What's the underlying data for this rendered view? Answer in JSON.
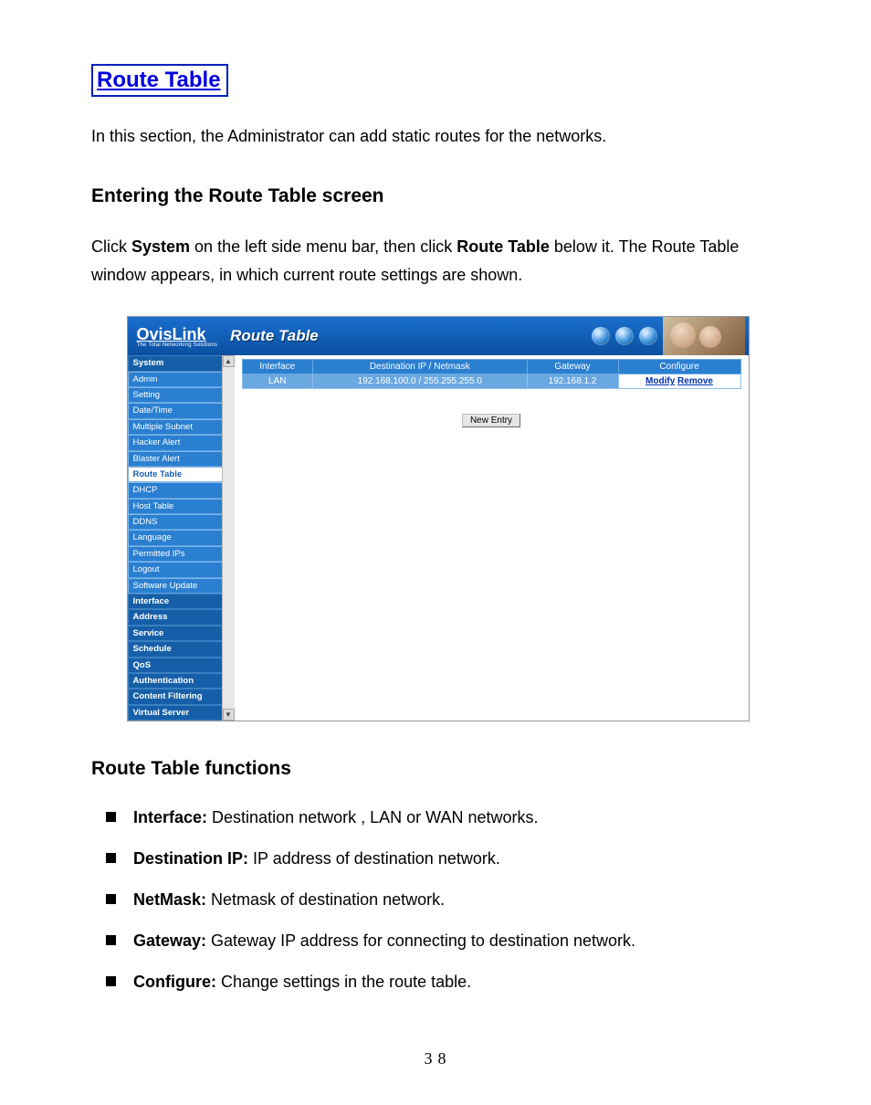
{
  "doc": {
    "section_title": "Route Table",
    "intro": "In this section, the Administrator can add static routes for the networks.",
    "sub1": "Entering the Route Table screen",
    "para1_a": "Click ",
    "para1_b": "System",
    "para1_c": " on the left side menu bar, then click ",
    "para1_d": "Route Table",
    "para1_e": " below it. The Route Table window appears, in which current route settings are shown.",
    "sub2": "Route Table functions",
    "page_number": "38"
  },
  "app": {
    "brand": "OvisLink",
    "brand_sub": "The Total Networking Solutions",
    "page_title": "Route Table",
    "sidebar": [
      {
        "label": "System",
        "type": "group"
      },
      {
        "label": "Admin",
        "type": "item"
      },
      {
        "label": "Setting",
        "type": "item"
      },
      {
        "label": "Date/Time",
        "type": "item"
      },
      {
        "label": "Multiple Subnet",
        "type": "item"
      },
      {
        "label": "Hacker Alert",
        "type": "item"
      },
      {
        "label": "Blaster Alert",
        "type": "item"
      },
      {
        "label": "Route Table",
        "type": "active"
      },
      {
        "label": "DHCP",
        "type": "item"
      },
      {
        "label": "Host Table",
        "type": "item"
      },
      {
        "label": "DDNS",
        "type": "item"
      },
      {
        "label": "Language",
        "type": "item"
      },
      {
        "label": "Permitted IPs",
        "type": "item"
      },
      {
        "label": "Logout",
        "type": "item"
      },
      {
        "label": "Software Update",
        "type": "item"
      },
      {
        "label": "Interface",
        "type": "group"
      },
      {
        "label": "Address",
        "type": "group"
      },
      {
        "label": "Service",
        "type": "group"
      },
      {
        "label": "Schedule",
        "type": "group"
      },
      {
        "label": "QoS",
        "type": "group"
      },
      {
        "label": "Authentication",
        "type": "group"
      },
      {
        "label": "Content Filtering",
        "type": "group"
      },
      {
        "label": "Virtual Server",
        "type": "group"
      }
    ],
    "table": {
      "headers": [
        "Interface",
        "Destination IP / Netmask",
        "Gateway",
        "Configure"
      ],
      "row": {
        "interface": "LAN",
        "dest": "192.168.100.0 / 255.255.255.0",
        "gateway": "192.168.1.2",
        "modify": "Modify",
        "remove": "Remove"
      }
    },
    "new_entry": "New Entry"
  },
  "functions": [
    {
      "term": "Interface:",
      "desc": " Destination network , LAN or WAN networks."
    },
    {
      "term": "Destination IP:",
      "desc": " IP address of destination network."
    },
    {
      "term": "NetMask:",
      "desc": " Netmask of destination network."
    },
    {
      "term": "Gateway:",
      "desc": " Gateway IP address for connecting to destination network."
    },
    {
      "term": "Configure:",
      "desc": " Change settings in the route table."
    }
  ]
}
